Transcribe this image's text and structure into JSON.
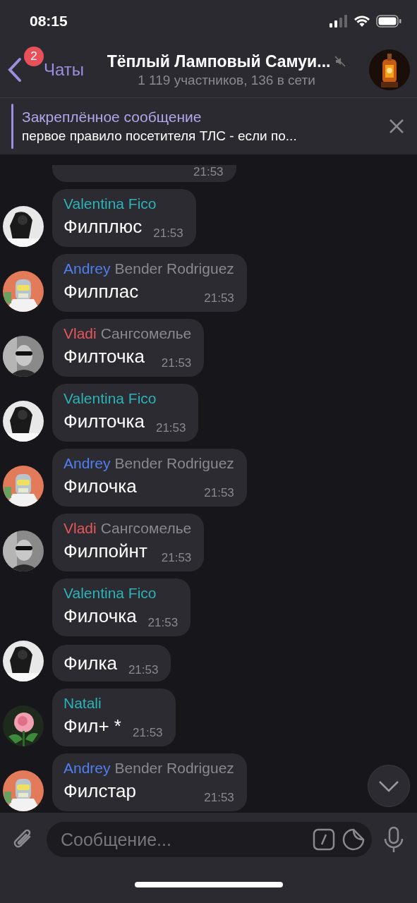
{
  "status_bar": {
    "time": "08:15"
  },
  "header": {
    "back_label": "Чаты",
    "unread_badge": "2",
    "title": "Тёплый Ламповый Самуи...",
    "muted": true,
    "subtitle": "1 119 участников, 136 в сети"
  },
  "pinned": {
    "title": "Закреплённое сообщение",
    "text": "первое правило посетителя ТЛС - если по..."
  },
  "messages": [
    {
      "time": "21:53"
    },
    {
      "author": "Valentina Fico",
      "color": "#2bb3b8",
      "text": "Филплюс",
      "time": "21:53",
      "avatar": {
        "kind": "figure"
      }
    },
    {
      "author": "Andrey",
      "author_extra": "Bender Rodriguez",
      "color": "#4f7ff0",
      "text": "Филплас",
      "time": "21:53",
      "avatar": {
        "kind": "bender"
      }
    },
    {
      "author": "Vladi",
      "author_extra": "Сангсомелье",
      "color": "#e4575a",
      "text": "Филточка",
      "time": "21:53",
      "avatar": {
        "kind": "man"
      }
    },
    {
      "author": "Valentina Fico",
      "color": "#2bb3b8",
      "text": "Филточка",
      "time": "21:53",
      "avatar": {
        "kind": "figure"
      }
    },
    {
      "author": "Andrey",
      "author_extra": "Bender Rodriguez",
      "color": "#4f7ff0",
      "text": "Филочка",
      "time": "21:53",
      "avatar": {
        "kind": "bender"
      }
    },
    {
      "author": "Vladi",
      "author_extra": "Сангсомелье",
      "color": "#e4575a",
      "text": "Филпойнт",
      "time": "21:53",
      "avatar": {
        "kind": "man"
      }
    },
    {
      "author": "Valentina Fico",
      "color": "#2bb3b8",
      "text": "Филочка",
      "time": "21:53"
    },
    {
      "text": "Филка",
      "time": "21:53",
      "avatar": {
        "kind": "figure"
      }
    },
    {
      "author": "Natali",
      "color": "#2bb3b8",
      "text": "Фил+ *",
      "time": "21:53",
      "avatar": {
        "kind": "rose"
      }
    },
    {
      "author": "Andrey",
      "author_extra": "Bender Rodriguez",
      "color": "#4f7ff0",
      "text": "Филстар",
      "time": "21:53",
      "avatar": {
        "kind": "bender"
      }
    }
  ],
  "input": {
    "placeholder": "Сообщение..."
  }
}
